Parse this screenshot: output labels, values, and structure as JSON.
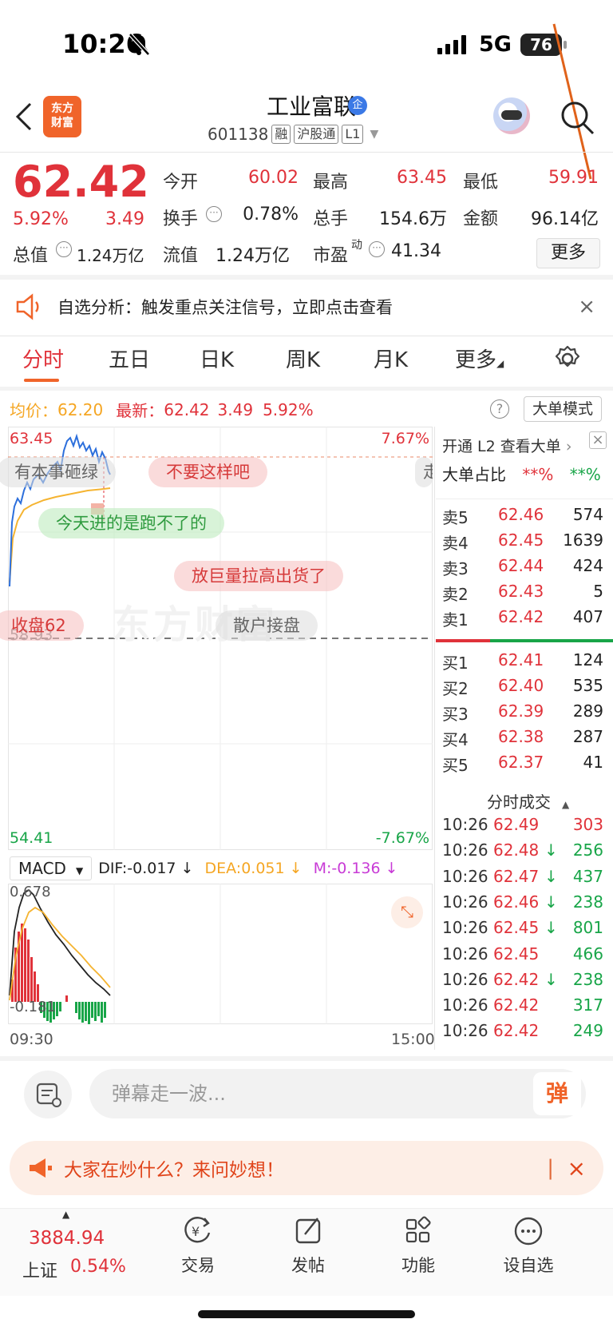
{
  "status_bar": {
    "time": "10:26",
    "network": "5G",
    "battery": "76"
  },
  "header": {
    "logo_text": "东方\n财富",
    "title": "工业富联",
    "title_badge": "企",
    "code": "601138",
    "tags": [
      "融",
      "沪股通",
      "L1"
    ]
  },
  "quote": {
    "price": "62.42",
    "change_pct": "5.92%",
    "change": "3.49",
    "open_label": "今开",
    "open": "60.02",
    "high_label": "最高",
    "high": "63.45",
    "low_label": "最低",
    "low": "59.91",
    "turnover_label": "换手",
    "turnover": "0.78%",
    "volume_label": "总手",
    "volume": "154.6万",
    "amount_label": "金额",
    "amount": "96.14亿",
    "mktcap_label": "总值",
    "mktcap": "1.24万亿",
    "float_label": "流值",
    "float_cap": "1.24万亿",
    "pe_label": "市盈",
    "pe_sup": "动",
    "pe": "41.34",
    "more_button": "更多"
  },
  "announcement": {
    "text": "自选分析：触发重点关注信号，立即点击查看"
  },
  "tabs": [
    "分时",
    "五日",
    "日K",
    "周K",
    "月K",
    "更多"
  ],
  "chart_header": {
    "avg_label": "均价：",
    "avg": "62.20",
    "latest_label": "最新：",
    "latest": "62.42",
    "latest_change": "3.49",
    "latest_pct": "5.92%",
    "mode_button": "大单模式",
    "help": "?"
  },
  "chart_labels": {
    "top_price": "63.45",
    "top_pct": "7.67%",
    "mid_price": "58.93",
    "bottom_price": "54.41",
    "bottom_pct": "-7.67%",
    "time_start": "09:30",
    "time_end": "15:00"
  },
  "danmaku": [
    "有本事砸绿",
    "不要这样吧",
    "今天进的是跑不了的",
    "放巨量拉高出货了",
    "收盘62",
    "散户接盘",
    "走"
  ],
  "macd": {
    "label": "MACD",
    "dif": "DIF:-0.017 ↓",
    "dea": "DEA:0.051 ↓",
    "m": "M:-0.136 ↓",
    "top": "0.678",
    "bottom": "-0.181"
  },
  "order_book": {
    "l2_text": "开通 L2 查看大单",
    "big_ratio_label": "大单占比",
    "big_buy": "**%",
    "big_sell": "**%",
    "asks": [
      {
        "label": "卖5",
        "price": "62.46",
        "vol": "574"
      },
      {
        "label": "卖4",
        "price": "62.45",
        "vol": "1639"
      },
      {
        "label": "卖3",
        "price": "62.44",
        "vol": "424"
      },
      {
        "label": "卖2",
        "price": "62.43",
        "vol": "5"
      },
      {
        "label": "卖1",
        "price": "62.42",
        "vol": "407"
      }
    ],
    "bids": [
      {
        "label": "买1",
        "price": "62.41",
        "vol": "124"
      },
      {
        "label": "买2",
        "price": "62.40",
        "vol": "535"
      },
      {
        "label": "买3",
        "price": "62.39",
        "vol": "289"
      },
      {
        "label": "买4",
        "price": "62.38",
        "vol": "287"
      },
      {
        "label": "买5",
        "price": "62.37",
        "vol": "41"
      }
    ],
    "ticks_title": "分时成交",
    "ticks": [
      {
        "time": "10:26",
        "price": "62.49",
        "arrow": "",
        "vol": "303",
        "dir": "up"
      },
      {
        "time": "10:26",
        "price": "62.48",
        "arrow": "↓",
        "vol": "256",
        "dir": "down"
      },
      {
        "time": "10:26",
        "price": "62.47",
        "arrow": "↓",
        "vol": "437",
        "dir": "down"
      },
      {
        "time": "10:26",
        "price": "62.46",
        "arrow": "↓",
        "vol": "238",
        "dir": "down"
      },
      {
        "time": "10:26",
        "price": "62.45",
        "arrow": "↓",
        "vol": "801",
        "dir": "down"
      },
      {
        "time": "10:26",
        "price": "62.45",
        "arrow": "",
        "vol": "466",
        "dir": "down"
      },
      {
        "time": "10:26",
        "price": "62.42",
        "arrow": "↓",
        "vol": "238",
        "dir": "down"
      },
      {
        "time": "10:26",
        "price": "62.42",
        "arrow": "",
        "vol": "317",
        "dir": "down"
      },
      {
        "time": "10:26",
        "price": "62.42",
        "arrow": "",
        "vol": "249",
        "dir": "down"
      }
    ]
  },
  "bottom": {
    "danmu_placeholder": "弹幕走一波...",
    "danmu_button": "弹",
    "ask_text": "大家在炒什么？来问妙想！",
    "index_value": "3884.94",
    "index_name": "上证",
    "index_pct": "0.54%",
    "nav": [
      "交易",
      "发帖",
      "功能",
      "设自选"
    ]
  },
  "watermark": "东方财富",
  "colors": {
    "up": "#e0323a",
    "down": "#18a548",
    "accent": "#f0642a",
    "avg": "#f5b431",
    "price_line": "#2c6fdc"
  }
}
